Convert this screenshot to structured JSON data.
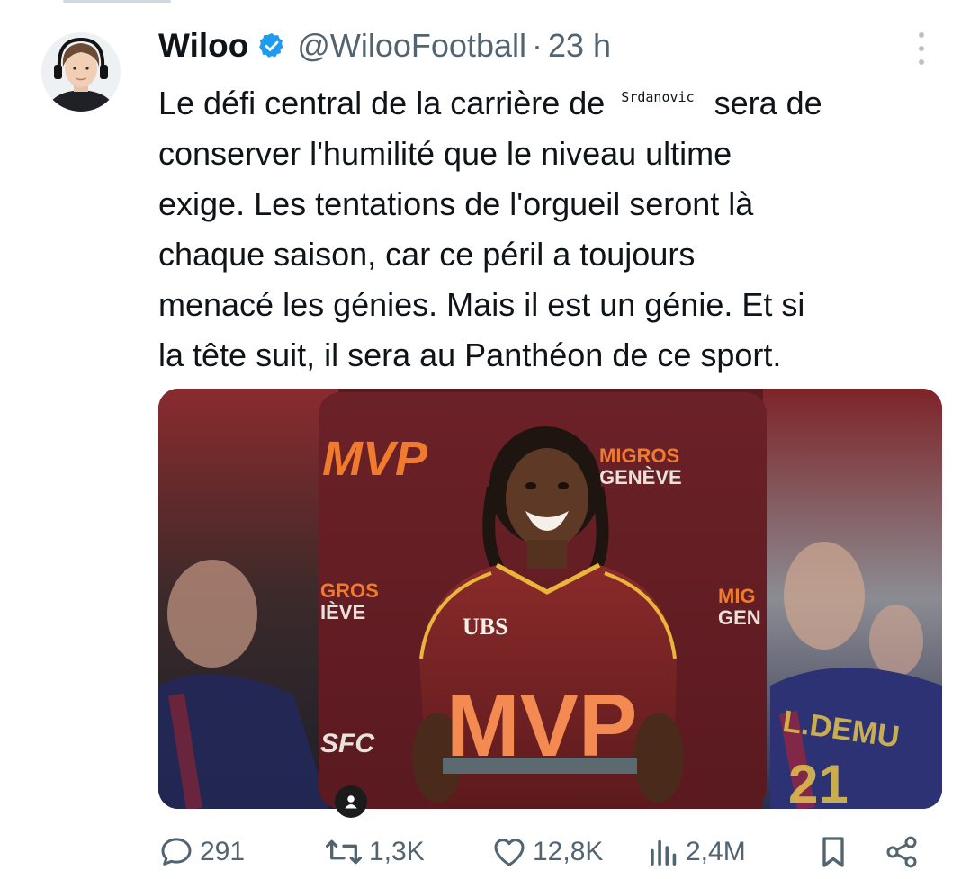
{
  "tweet": {
    "author_name": "Wiloo",
    "handle": "@WilooFootball",
    "separator": "·",
    "time": "23 h",
    "text_lines": [
      "Le défi central de la carrière de",
      "sera de",
      "conserver l'humilité que le niveau ultime",
      "exige. Les tentations de l'orgueil seront là",
      "chaque saison, car ce péril a toujours",
      "menacé les génies. Mais il est un génie. Et si",
      "la tête suit, il sera au Panthéon de ce sport."
    ],
    "redaction_label": "Srdanovic"
  },
  "media": {
    "image_texts": {
      "mvp_logo": "MVP",
      "sponsor_line1": "MIGROS",
      "sponsor_line2": "GENÈVE",
      "left_sponsor_line1": "GROS",
      "left_sponsor_line2": "IÈVE",
      "right_sponsor_line1": "MIG",
      "right_sponsor_line2": "GEN",
      "sfc": "SFC",
      "shirt_sponsor": "UBS",
      "trophy": "MVP"
    }
  },
  "actions": {
    "replies": "291",
    "retweets": "1,3K",
    "likes": "12,8K",
    "views": "2,4M"
  },
  "colors": {
    "verified_blue": "#1d9bf0",
    "muted_text": "#536471",
    "jersey": "#7a1f24",
    "backdrop": "#5a1b20",
    "accent_orange": "#f07a2d"
  },
  "icons": [
    "verified-icon",
    "more-icon",
    "reply-icon",
    "retweet-icon",
    "like-icon",
    "views-icon",
    "bookmark-icon",
    "share-icon",
    "media-user-icon"
  ]
}
